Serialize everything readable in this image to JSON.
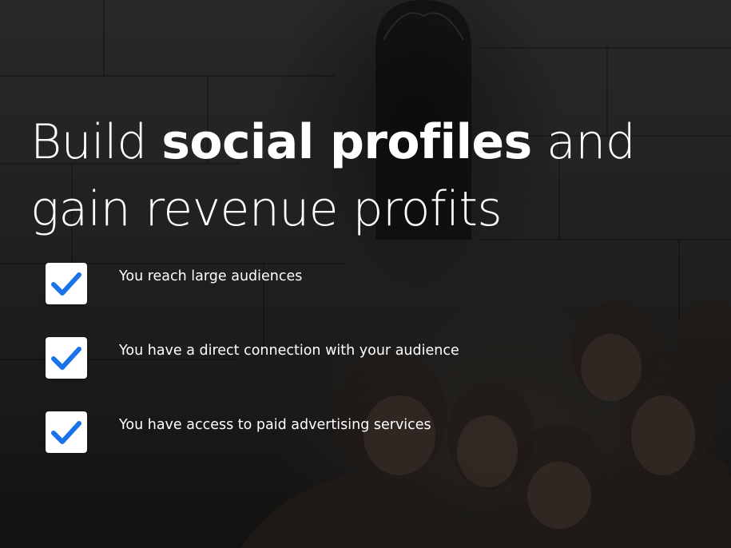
{
  "hero": {
    "headline": {
      "part1": "Build ",
      "emphasis": "social profiles",
      "part2": " and gain revenue profits"
    },
    "features": [
      {
        "label": "You reach large audiences",
        "icon": "checkmark-icon"
      },
      {
        "label": "You have a direct connection with your audience",
        "icon": "checkmark-icon"
      },
      {
        "label": "You have access to paid advertising services",
        "icon": "checkmark-icon"
      }
    ]
  },
  "colors": {
    "check": "#1a73e8",
    "check_box": "#ffffff",
    "text": "#ffffff"
  }
}
